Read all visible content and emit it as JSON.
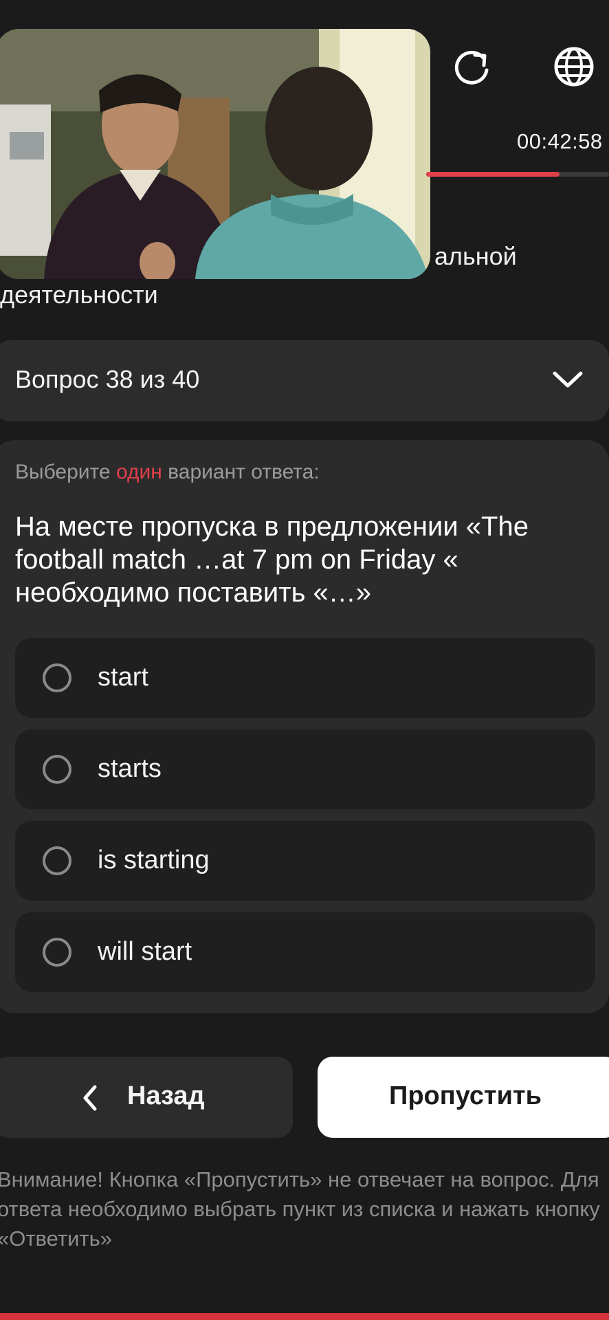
{
  "header": {
    "timer": "00:42:58",
    "timer_progress": 0.73,
    "icons": [
      "refresh-icon",
      "globe-icon"
    ]
  },
  "title": {
    "line1_tail": "альной",
    "line2": "деятельности"
  },
  "question_selector": {
    "label": "Вопрос 38 из 40",
    "icon": "chevron-down-icon"
  },
  "question": {
    "hint_before": "Выберите ",
    "hint_accent": "один",
    "hint_after": " вариант ответа:",
    "text": "На месте пропуска в предложении «The football match …at 7 pm on Friday « необходимо поставить «…»",
    "options": [
      {
        "label": "start",
        "selected": false
      },
      {
        "label": "starts",
        "selected": false
      },
      {
        "label": "is starting",
        "selected": false
      },
      {
        "label": "will start",
        "selected": false
      }
    ]
  },
  "buttons": {
    "back_label": "Назад",
    "skip_label": "Пропустить"
  },
  "notice": "Внимание! Кнопка «Пропустить» не отвечает на вопрос. Для ответа необходимо выбрать пункт из списка и нажать кнопку «Ответить»",
  "colors": {
    "accent": "#e0404a",
    "background": "#1b1b1b",
    "card": "#2b2b2b",
    "option": "#1f1f1f"
  }
}
